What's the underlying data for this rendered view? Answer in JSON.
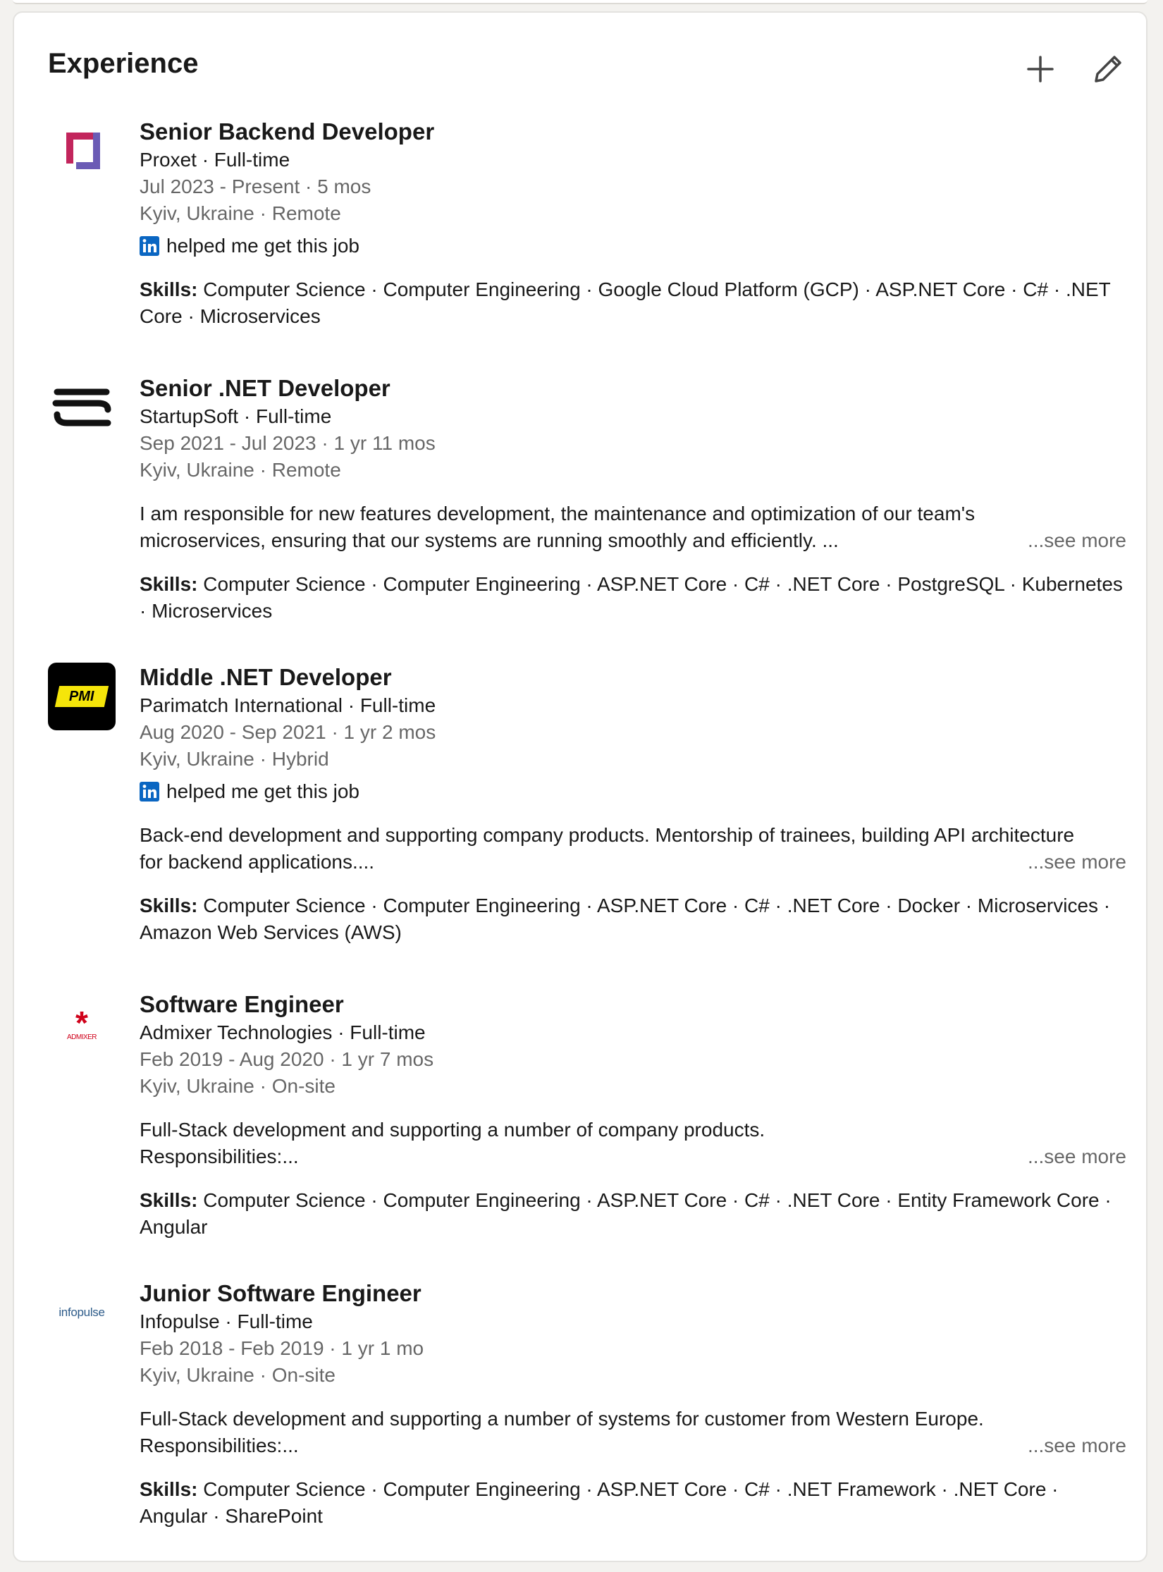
{
  "section": {
    "title": "Experience",
    "add_label": "Add experience",
    "edit_label": "Edit experience"
  },
  "entries": [
    {
      "title": "Senior Backend Developer",
      "company": "Proxet · Full-time",
      "dates": "Jul 2023 - Present · 5 mos",
      "location": "Kyiv, Ukraine · Remote",
      "helped": "helped me get this job",
      "description_line1": "",
      "description_line2": "",
      "see_more": "",
      "skills_label": "Skills:",
      "skills": "Computer Science · Computer Engineering · Google Cloud Platform (GCP) · ASP.NET Core · C# · .NET Core · Microservices",
      "logo": "proxet-logo"
    },
    {
      "title": "Senior .NET Developer",
      "company": "StartupSoft · Full-time",
      "dates": "Sep 2021 - Jul 2023 · 1 yr 11 mos",
      "location": "Kyiv, Ukraine · Remote",
      "helped": "",
      "description_line1": "I am responsible for new features development, the maintenance and optimization of our team's",
      "description_line2": "microservices, ensuring that our systems are running smoothly and efficiently. ...",
      "see_more": "...see more",
      "skills_label": "Skills:",
      "skills": "Computer Science · Computer Engineering · ASP.NET Core · C# · .NET Core · PostgreSQL · Kubernetes · Microservices",
      "logo": "startupsoft-logo"
    },
    {
      "title": "Middle .NET Developer",
      "company": "Parimatch International · Full-time",
      "dates": "Aug 2020 - Sep 2021 · 1 yr 2 mos",
      "location": "Kyiv, Ukraine · Hybrid",
      "helped": "helped me get this job",
      "description_line1": "Back-end development and supporting company products. Mentorship of trainees, building API architecture",
      "description_line2": "for backend applications....",
      "see_more": "...see more",
      "skills_label": "Skills:",
      "skills": "Computer Science · Computer Engineering · ASP.NET Core · C# · .NET Core · Docker · Microservices · Amazon Web Services (AWS)",
      "logo": "pmi-logo",
      "logo_text": "PMI"
    },
    {
      "title": "Software Engineer",
      "company": "Admixer Technologies · Full-time",
      "dates": "Feb 2019 - Aug 2020 · 1 yr 7 mos",
      "location": "Kyiv, Ukraine · On-site",
      "helped": "",
      "description_line1": "Full-Stack development and supporting a number of company products.",
      "description_line2": "Responsibilities:...",
      "see_more": "...see more",
      "skills_label": "Skills:",
      "skills": "Computer Science · Computer Engineering · ASP.NET Core · C# · .NET Core · Entity Framework Core · Angular",
      "logo": "admixer-logo",
      "logo_text": "ADMIXER"
    },
    {
      "title": "Junior Software Engineer",
      "company": "Infopulse · Full-time",
      "dates": "Feb 2018 - Feb 2019 · 1 yr 1 mo",
      "location": "Kyiv, Ukraine · On-site",
      "helped": "",
      "description_line1": "Full-Stack development and supporting a number of systems for customer from Western Europe.",
      "description_line2": "Responsibilities:...",
      "see_more": "...see more",
      "skills_label": "Skills:",
      "skills": "Computer Science · Computer Engineering · ASP.NET Core · C# · .NET Framework · .NET Core · Angular · SharePoint",
      "logo": "infopulse-logo",
      "logo_text": "infopulse"
    }
  ],
  "colors": {
    "linkedin_blue": "#0a66c2",
    "pmi_yellow": "#f5e50a",
    "admixer_red": "#d0021b"
  }
}
